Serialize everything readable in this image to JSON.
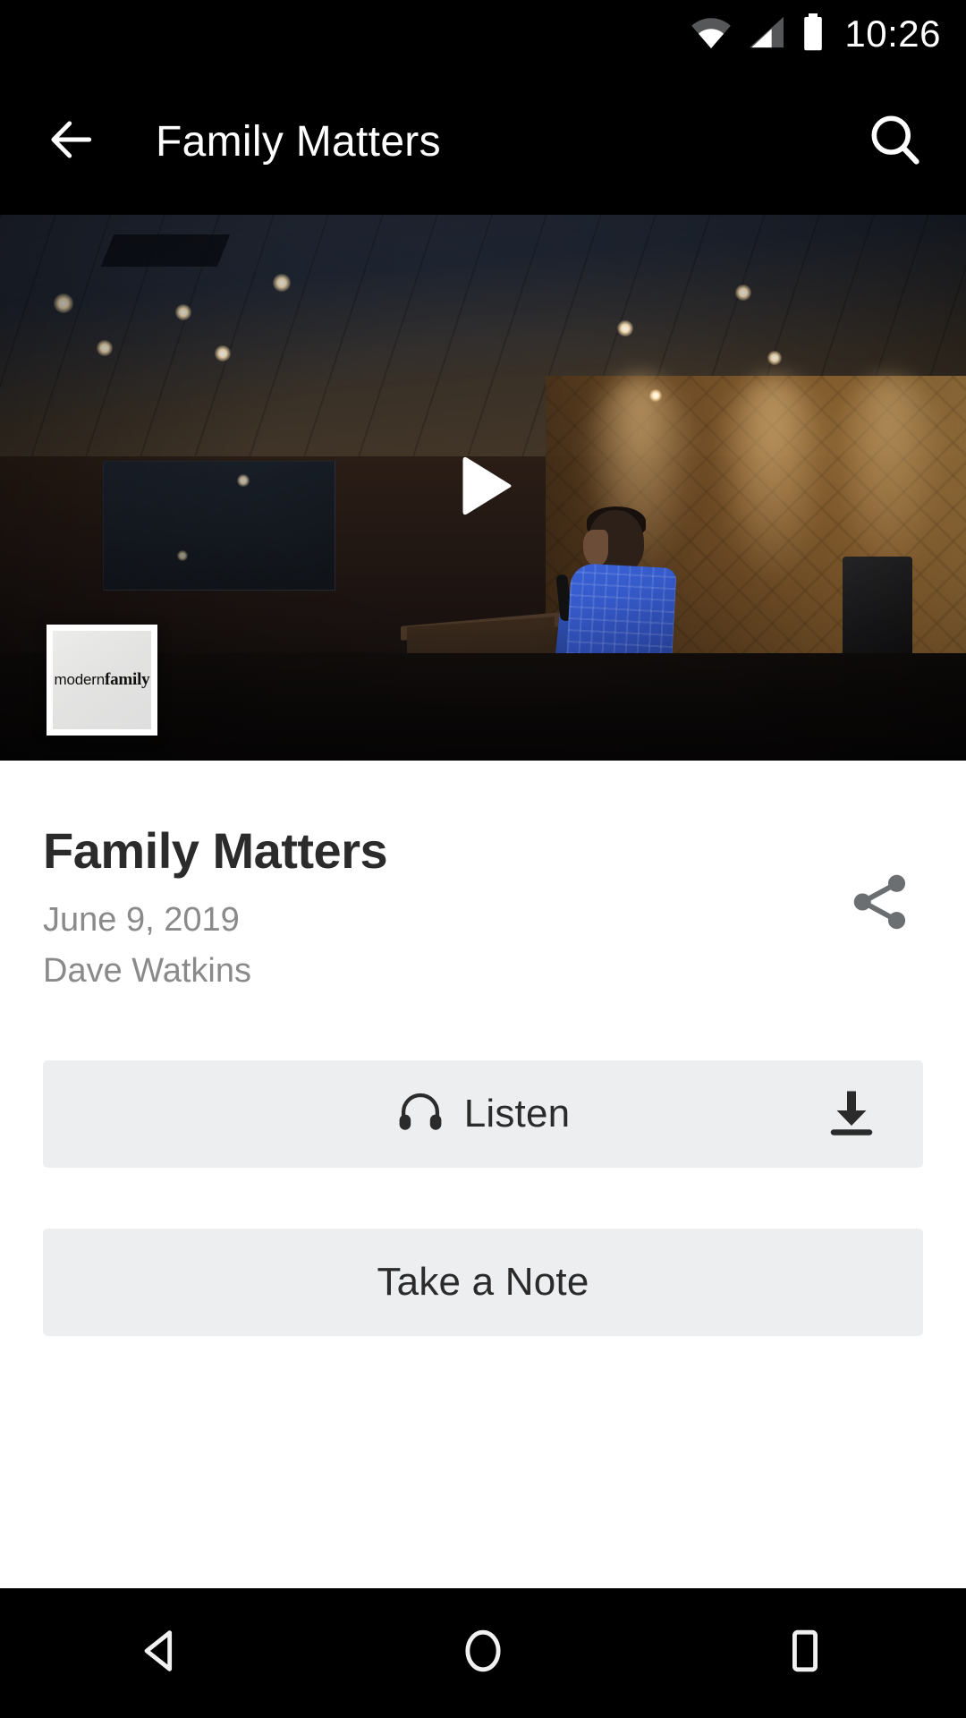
{
  "status_bar": {
    "clock": "10:26",
    "icons": [
      "wifi-icon",
      "cellular-signal-icon",
      "battery-icon"
    ]
  },
  "app_bar": {
    "back_icon": "arrow-back-icon",
    "title": "Family Matters",
    "search_icon": "search-icon"
  },
  "video": {
    "play_icon": "play-icon",
    "series_thumbnail": {
      "text_light": "modern",
      "text_bold": "family"
    }
  },
  "details": {
    "title": "Family Matters",
    "date": "June 9, 2019",
    "speaker": "Dave Watkins",
    "share_icon": "share-icon"
  },
  "actions": {
    "listen_label": "Listen",
    "listen_icon": "headphones-icon",
    "download_icon": "download-icon",
    "note_label": "Take a Note"
  },
  "nav_bar": {
    "back_label": "back-icon",
    "home_label": "home-icon",
    "recents_label": "recents-icon"
  },
  "colors": {
    "app_bar_bg": "#000000",
    "page_bg": "#ffffff",
    "button_bg": "#ECEEF0",
    "title_text": "#2b2b2b",
    "meta_text": "#8a8a8a",
    "icon_gray": "#6b6f72"
  }
}
